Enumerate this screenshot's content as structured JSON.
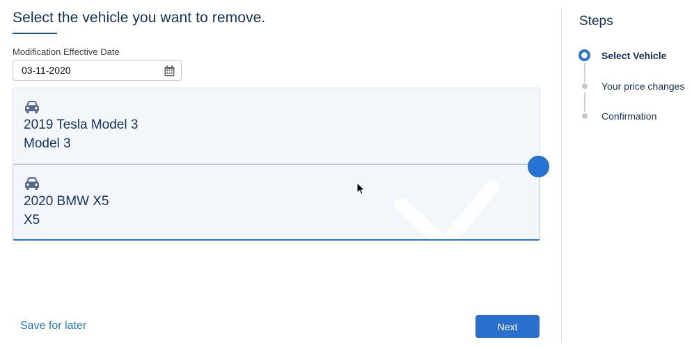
{
  "page": {
    "title": "Select the vehicle you want to remove."
  },
  "date_field": {
    "label": "Modification Effective Date",
    "value": "03-11-2020",
    "icon": "calendar-icon"
  },
  "vehicles": [
    {
      "title": "2019 Tesla Model 3",
      "model": "Model 3",
      "icon": "car-icon",
      "selected": false
    },
    {
      "title": "2020 BMW X5",
      "model": "X5",
      "icon": "car-icon",
      "selected": true
    }
  ],
  "footer": {
    "save_label": "Save for later",
    "next_label": "Next"
  },
  "steps": {
    "title": "Steps",
    "items": [
      {
        "label": "Select Vehicle",
        "state": "active"
      },
      {
        "label": "Your price changes",
        "state": "pending"
      },
      {
        "label": "Confirmation",
        "state": "pending"
      }
    ]
  },
  "colors": {
    "brand": "#2574d4",
    "text": "#16325c",
    "link": "#1b76d3"
  }
}
